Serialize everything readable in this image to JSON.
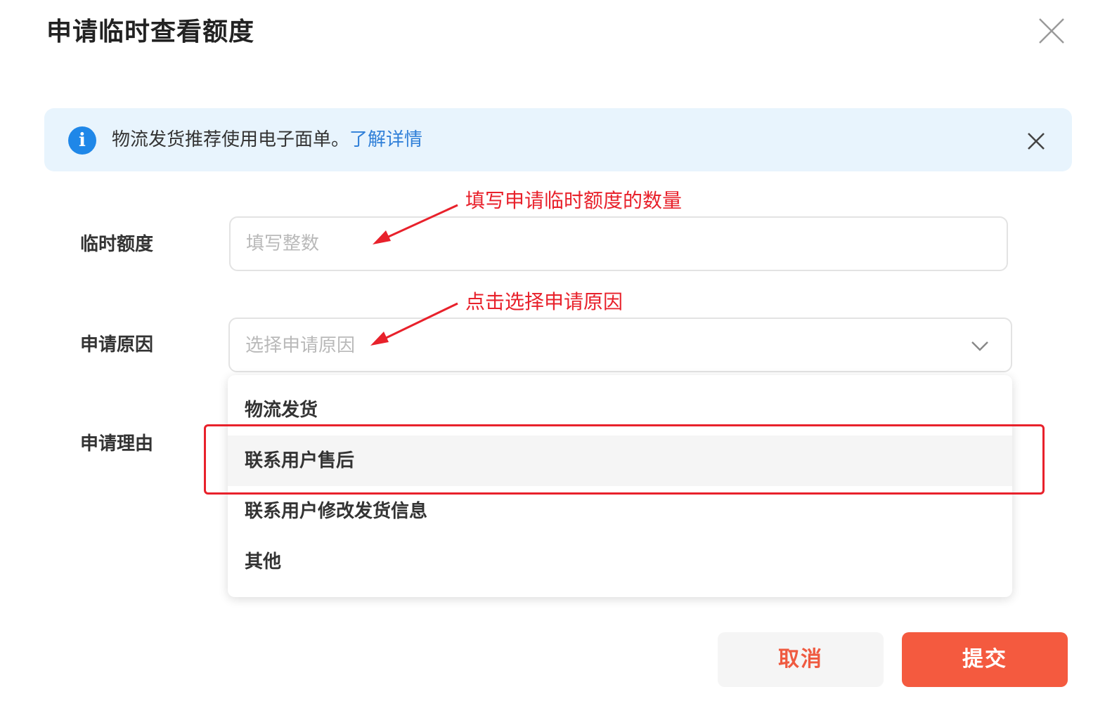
{
  "dialog": {
    "title": "申请临时查看额度",
    "close_icon": "close-icon"
  },
  "notice": {
    "icon": "info-icon",
    "text": "物流发货推荐使用电子面单。",
    "link": "了解详情",
    "close_icon": "close-icon",
    "background": "#e8f4fd",
    "icon_color": "#1f87e8",
    "link_color": "#2f7fd8"
  },
  "form": {
    "quota": {
      "label": "临时额度",
      "value": "",
      "placeholder": "填写整数"
    },
    "reason": {
      "label": "申请原因",
      "placeholder": "选择申请原因",
      "icon": "chevron-down-icon",
      "options": [
        "物流发货",
        "联系用户售后",
        "联系用户修改发货信息",
        "其他"
      ],
      "hovered_option": "联系用户售后"
    },
    "detail": {
      "label": "申请理由"
    }
  },
  "annotations": {
    "quota_hint": "填写申请临时额度的数量",
    "reason_hint": "点击选择申请原因",
    "color": "#e8212b"
  },
  "buttons": {
    "cancel": "取消",
    "submit": "提交",
    "submit_color": "#f45a3f",
    "cancel_text_color": "#ef5a40"
  }
}
